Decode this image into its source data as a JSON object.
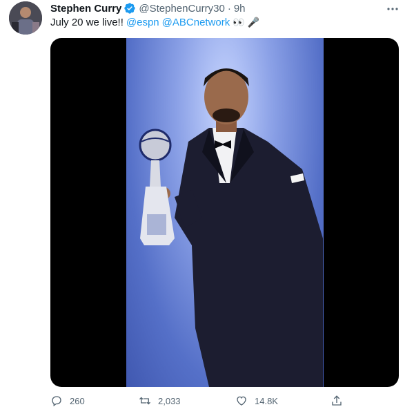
{
  "tweet": {
    "author_name": "Stephen Curry",
    "handle": "@StephenCurry30",
    "separator": "·",
    "time": "9h",
    "more_icon": "more-icon",
    "text_prefix": "July 20 we live!!",
    "mentions": [
      "@espn",
      "@ABCnetwork"
    ],
    "emoji": "👀 🎤"
  },
  "actions": {
    "replies": "260",
    "retweets": "2,033",
    "likes": "14.8K"
  },
  "colors": {
    "link": "#1d9bf0",
    "verified": "#1d9bf0",
    "meta": "#536471"
  }
}
